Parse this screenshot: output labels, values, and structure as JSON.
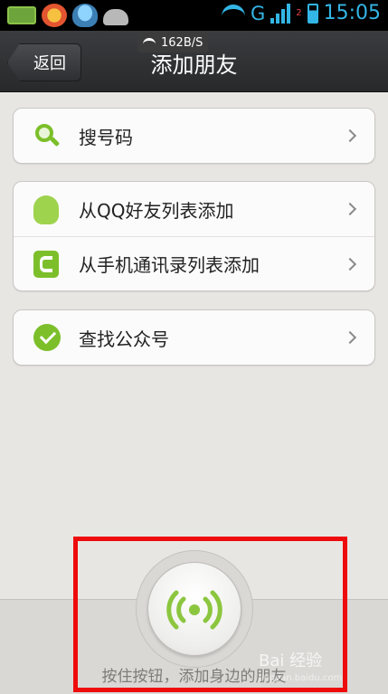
{
  "status_bar": {
    "network_type": "G",
    "sim_index": "2",
    "time": "15:05"
  },
  "header": {
    "back_label": "返回",
    "title": "添加朋友",
    "net_speed": "162B/S"
  },
  "groups": [
    {
      "items": [
        {
          "label": "搜号码",
          "icon": "search-icon"
        }
      ]
    },
    {
      "items": [
        {
          "label": "从QQ好友列表添加",
          "icon": "qq-icon"
        },
        {
          "label": "从手机通讯录列表添加",
          "icon": "phone-contact-icon"
        }
      ]
    },
    {
      "items": [
        {
          "label": "查找公众号",
          "icon": "check-circle-icon"
        }
      ]
    }
  ],
  "radar": {
    "hint": "按住按钮，添加身边的朋友",
    "icon": "radar-signal-icon"
  },
  "watermark": {
    "brand": "Bai 经验",
    "url": "jingyan.baidu.com"
  },
  "colors": {
    "accent_green": "#7cbf2a",
    "highlight_red": "#ee0b0b",
    "status_blue": "#33b5e5"
  }
}
